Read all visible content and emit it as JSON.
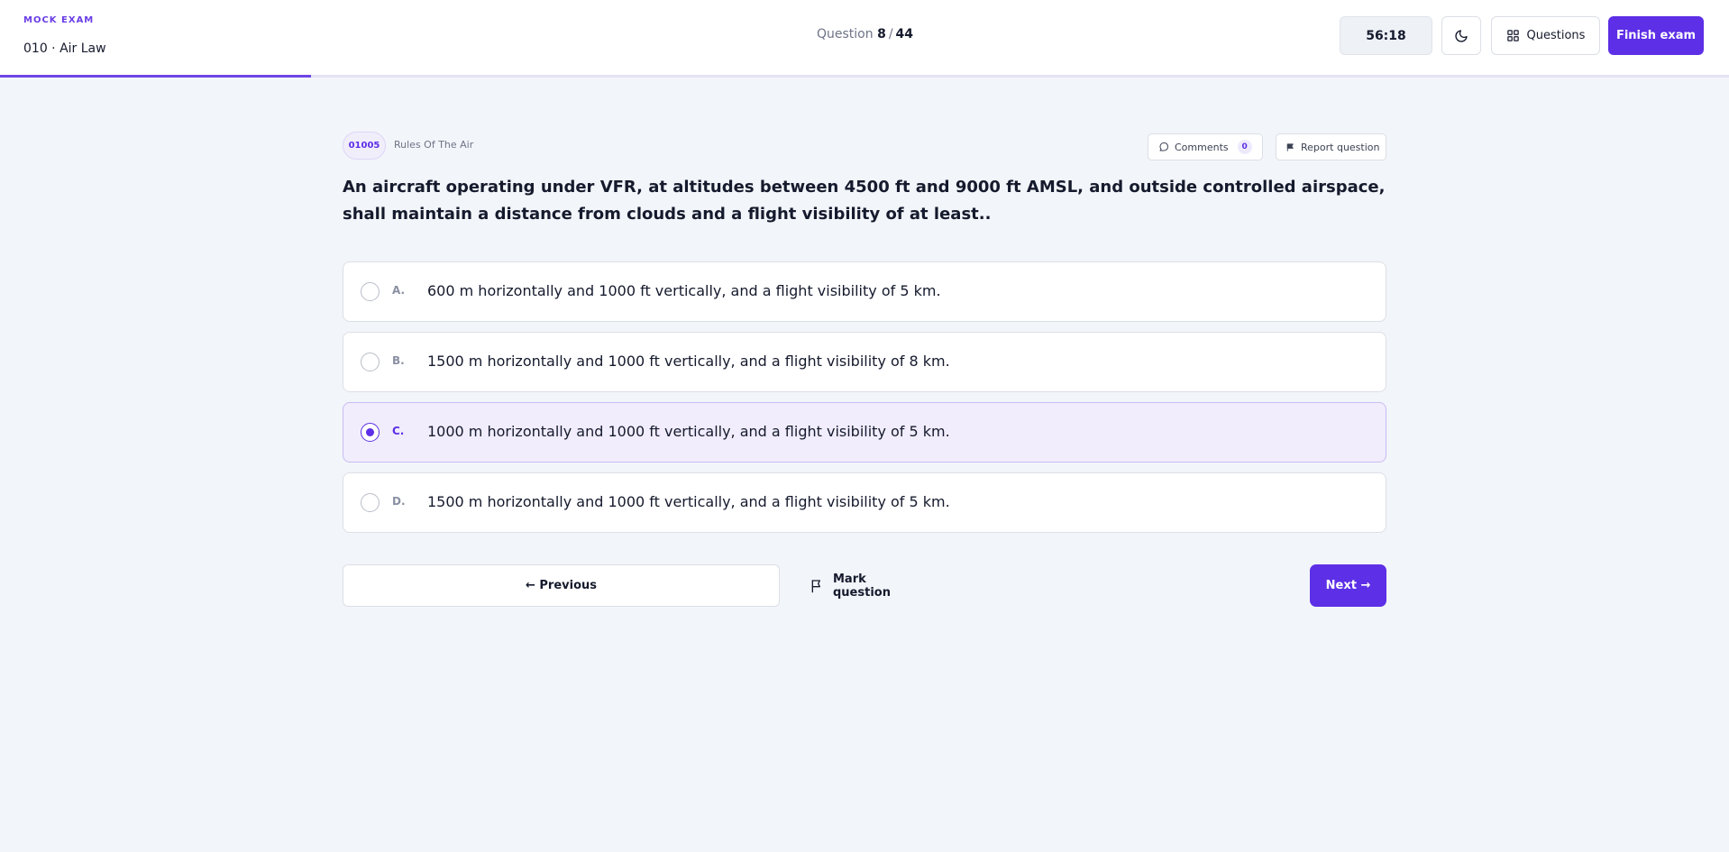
{
  "header": {
    "exam_kind": "MOCK EXAM",
    "exam_name": "010 · Air Law",
    "counter_label": "Question",
    "current_question": "8",
    "separator": "/",
    "total_questions": "44",
    "timer": "56:18",
    "questions_label": "Questions",
    "finish_label": "Finish exam",
    "progress_fraction": 0.18
  },
  "question": {
    "id": "01005",
    "topic": "Rules Of The Air",
    "comments_label": "Comments",
    "comments_count": "0",
    "report_label": "Report question",
    "text": "An aircraft operating under VFR, at altitudes between 4500 ft and 9000 ft AMSL, and outside controlled airspace, shall maintain a distance from clouds and a flight visibility of at least..",
    "options": [
      {
        "letter": "A.",
        "text": "600 m horizontally and 1000 ft vertically, and a flight visibility of 5 km.",
        "selected": false
      },
      {
        "letter": "B.",
        "text": "1500 m horizontally and 1000 ft vertically, and a flight visibility of 8 km.",
        "selected": false
      },
      {
        "letter": "C.",
        "text": "1000 m horizontally and 1000 ft vertically, and a flight visibility of 5 km.",
        "selected": true
      },
      {
        "letter": "D.",
        "text": "1500 m horizontally and 1000 ft vertically, and a flight visibility of 5 km.",
        "selected": false
      }
    ]
  },
  "nav": {
    "previous_label": "← Previous",
    "mark_label": "Mark question",
    "next_label": "Next →"
  },
  "icons": {
    "theme": "moon-icon",
    "questions": "grid-icon",
    "comments": "comment-icon",
    "report": "flag-icon",
    "mark": "flag-outline-icon"
  },
  "colors": {
    "accent": "#5d2fe6",
    "background": "#f2f5f9",
    "selected_option": "#f1edfd"
  }
}
